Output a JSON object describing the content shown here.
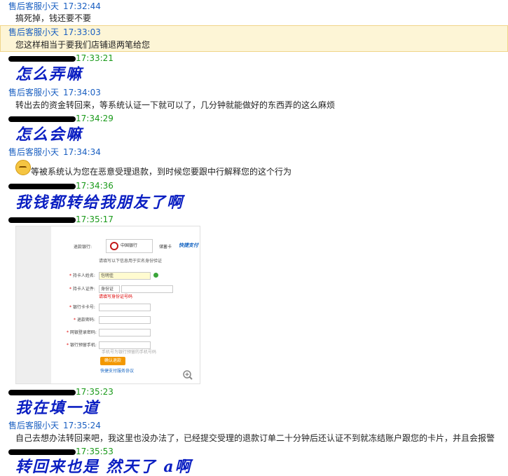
{
  "messages": {
    "m1": {
      "sender": "售后客服小天",
      "time": "17:32:44",
      "text": "搞死掉，钱还要不要"
    },
    "m2": {
      "sender": "售后客服小天",
      "time": "17:33:03",
      "text": "您这样相当于要我们店铺退两笔给您"
    },
    "m3": {
      "time": "17:33:21",
      "handwriting": "怎么弄嘛"
    },
    "m4": {
      "sender": "售后客服小天",
      "time": "17:34:03",
      "text": "转出去的资金转回来，等系统认证一下就可以了，几分钟就能做好的东西弄的这么麻烦"
    },
    "m5": {
      "time": "17:34:29",
      "handwriting": "怎么会嘛"
    },
    "m6": {
      "sender": "售后客服小天",
      "time": "17:34:34",
      "text": "等被系统认为您在恶意受理退款，到时候您要跟中行解释您的这个行为"
    },
    "m7": {
      "time": "17:34:36",
      "handwriting": "我钱都转给我朋友了啊"
    },
    "m8": {
      "time": "17:35:17"
    },
    "m9": {
      "time": "17:35:23",
      "handwriting": "我在填一道"
    },
    "m10": {
      "sender": "售后客服小天",
      "time": "17:35:24",
      "text": "自己去想办法转回来吧，我这里也没办法了，已经提交受理的退款订单二十分钟后还认证不到就冻结账户跟您的卡片，并且会报警"
    },
    "m11": {
      "time": "17:35:53",
      "handwriting": "转回来也是 然天了 a啊"
    }
  },
  "embedded_form": {
    "bank_label": "退款银行:",
    "bank_name": "中国银行",
    "card_type": "储蓄卡",
    "kuaijie": "快捷支付",
    "hint": "请填写以下信息用于实名身份验证",
    "name_label": "持卡人姓名:",
    "name_value": "包明佳",
    "id_label": "持卡人证件:",
    "id_type": "身份证",
    "id_hint": "请填写身份证号码",
    "card_label": "银行卡卡号:",
    "pwd_label": "退款密码:",
    "login_pwd_label": "网银登录密码:",
    "phone_label": "银行预留手机:",
    "phone_hint": "手机号为银行预留的手机号码",
    "confirm_button": "确认退款",
    "footer_link": "快捷支付服务协议"
  },
  "colors": {
    "sender": "#1a5fc1",
    "customer_time": "#1a9a1a",
    "highlight_bg": "#fdf5d6",
    "handwriting": "#0b1fc2"
  }
}
